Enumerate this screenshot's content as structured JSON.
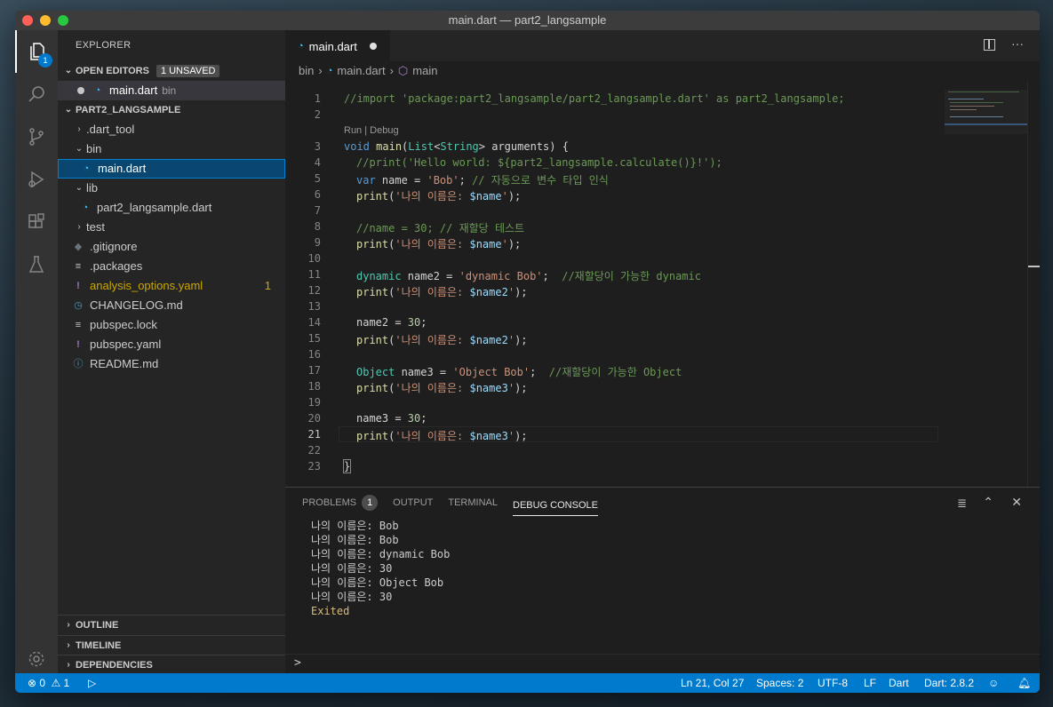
{
  "window": {
    "title": "main.dart — part2_langsample"
  },
  "activity": {
    "explorer_badge": "1"
  },
  "sidebar": {
    "title": "EXPLORER",
    "open_editors_label": "OPEN EDITORS",
    "unsaved_badge": "1 UNSAVED",
    "open_file": {
      "name": "main.dart",
      "dir": "bin"
    },
    "project_label": "PART2_LANGSAMPLE",
    "tree": [
      {
        "name": ".dart_tool"
      },
      {
        "name": "bin"
      },
      {
        "name": "main.dart"
      },
      {
        "name": "lib"
      },
      {
        "name": "part2_langsample.dart"
      },
      {
        "name": "test"
      },
      {
        "name": ".gitignore"
      },
      {
        "name": ".packages"
      },
      {
        "name": "analysis_options.yaml",
        "count": "1"
      },
      {
        "name": "CHANGELOG.md"
      },
      {
        "name": "pubspec.lock"
      },
      {
        "name": "pubspec.yaml"
      },
      {
        "name": "README.md"
      }
    ],
    "outline_label": "OUTLINE",
    "timeline_label": "TIMELINE",
    "dependencies_label": "DEPENDENCIES"
  },
  "editor": {
    "tab_label": "main.dart",
    "breadcrumb": {
      "folder": "bin",
      "file": "main.dart",
      "symbol": "main"
    },
    "codelens": "Run | Debug",
    "line_numbers": [
      "1",
      "2",
      "3",
      "4",
      "5",
      "6",
      "7",
      "8",
      "9",
      "10",
      "11",
      "12",
      "13",
      "14",
      "15",
      "16",
      "17",
      "18",
      "19",
      "20",
      "21",
      "22",
      "23"
    ],
    "lines": {
      "l1": "//import 'package:part2_langsample/part2_langsample.dart' as part2_langsample;",
      "l3a": "void",
      "l3b": "main",
      "l3c": "(",
      "l3d": "List",
      "l3e": "<",
      "l3f": "String",
      "l3g": "> arguments) {",
      "l4": "//print('Hello world: ${part2_langsample.calculate()}!');",
      "l5a": "var",
      "l5b": " name = ",
      "l5c": "'Bob'",
      "l5d": "; ",
      "l5e": "// 자동으로 변수 타입 인식",
      "print_kw": "print",
      "open": "(",
      "str_prefix": "'나의 이름은: ",
      "str_suffix": "'",
      "close": ");",
      "var_name": "$name",
      "var_name2": "$name2",
      "var_name3": "$name3",
      "l8": "//name = 30; // 재할당 테스트",
      "l11a": "dynamic",
      "l11b": " name2 = ",
      "l11c": "'dynamic Bob'",
      "l11d": ";  ",
      "l11e": "//재할당이 가능한 dynamic",
      "l14a": "name2 = ",
      "l14b": "30",
      "l14c": ";",
      "l17a": "Object",
      "l17b": " name3 = ",
      "l17c": "'Object Bob'",
      "l17d": ";  ",
      "l17e": "//재할당이 가능한 Object",
      "l20a": "name3 = ",
      "l20b": "30",
      "l20c": ";",
      "l23": "}"
    }
  },
  "panel": {
    "tabs": [
      "PROBLEMS",
      "OUTPUT",
      "TERMINAL",
      "DEBUG CONSOLE"
    ],
    "problems_count": "1",
    "output": [
      "나의 이름은: Bob",
      "나의 이름은: Bob",
      "나의 이름은: dynamic Bob",
      "나의 이름은: 30",
      "나의 이름은: Object Bob",
      "나의 이름은: 30"
    ],
    "exited": "Exited",
    "prompt": ">"
  },
  "status": {
    "errors": "0",
    "warnings": "1",
    "position": "Ln 21, Col 27",
    "spaces": "Spaces: 2",
    "encoding": "UTF-8",
    "eol": "LF",
    "language": "Dart",
    "sdk": "Dart: 2.8.2"
  },
  "colors": {
    "accent": "#007acc",
    "selection": "#094771",
    "warning": "#cca700",
    "exited": "#d7ba7d"
  }
}
